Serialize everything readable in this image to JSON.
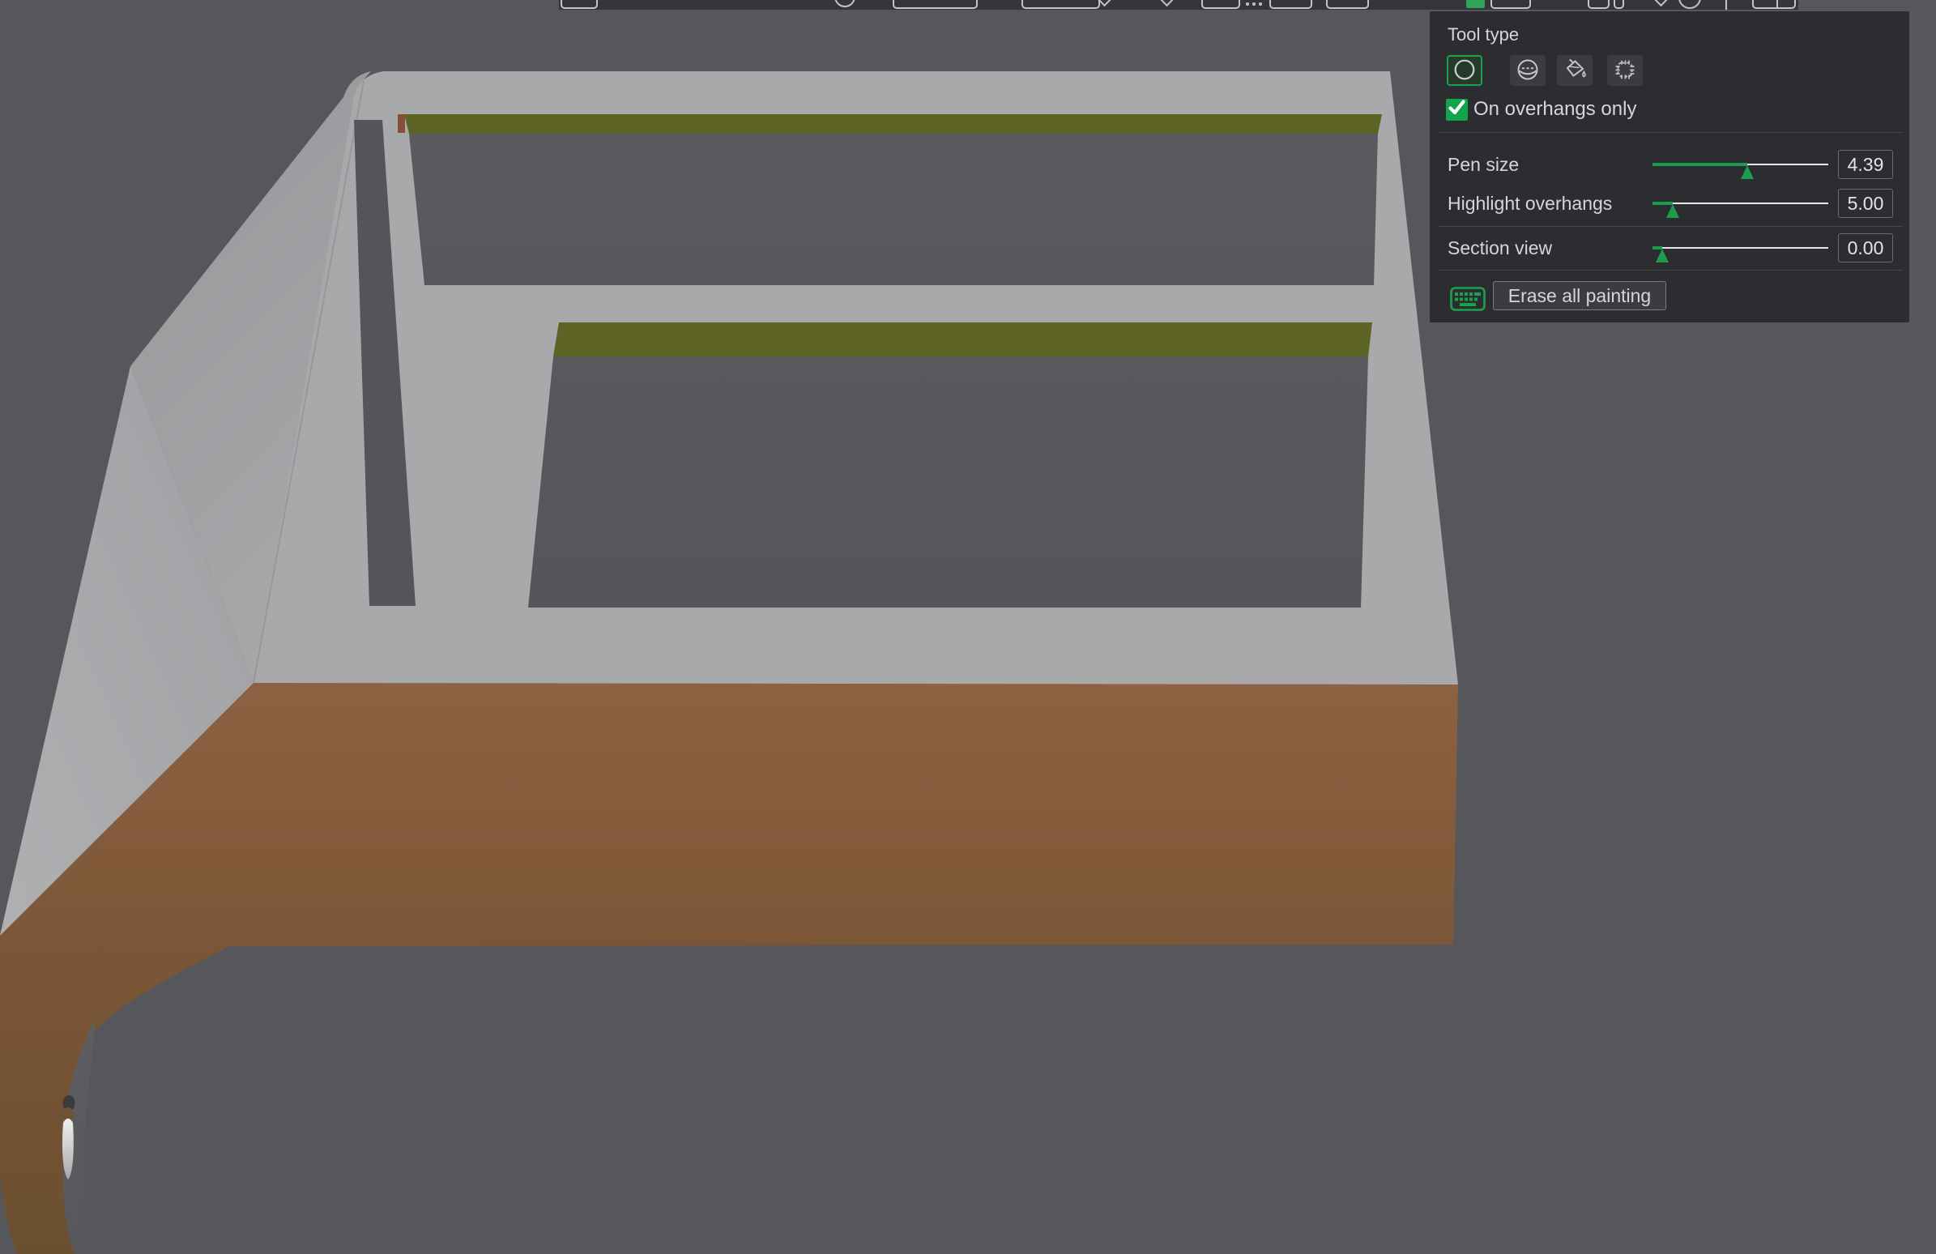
{
  "panel": {
    "title": "Tool type",
    "tools": [
      {
        "name": "circle-brush",
        "selected": true
      },
      {
        "name": "sphere-brush",
        "selected": false
      },
      {
        "name": "fill-bucket",
        "selected": false
      },
      {
        "name": "smart-fill",
        "selected": false
      }
    ],
    "checkbox": {
      "label": "On overhangs only",
      "checked": true
    },
    "sliders": [
      {
        "label": "Pen size",
        "value": "4.39",
        "fill_pct": 54
      },
      {
        "label": "Highlight overhangs",
        "value": "5.00",
        "fill_pct": 11.5
      },
      {
        "label": "Section view",
        "value": "0.00",
        "fill_pct": 5.5
      }
    ],
    "erase_button_label": "Erase all painting"
  },
  "colors": {
    "accent_green": "#1CA24E",
    "checkbox_green": "#12A44B",
    "slider_green": "#1E9C4D",
    "panel_bg": "#2B2D30",
    "toolbar_bg": "#34363B",
    "viewport_bg": "#56575B",
    "model_top_gray": "#A8A9AB",
    "overhang_paint_olive": "#5C6323",
    "model_bottom_brown": "#8D6142",
    "inner_wall_gray": "#595A5E"
  },
  "viewport": {
    "description": "3D model of a bracket with two rectangular openings; overhang areas painted olive"
  }
}
